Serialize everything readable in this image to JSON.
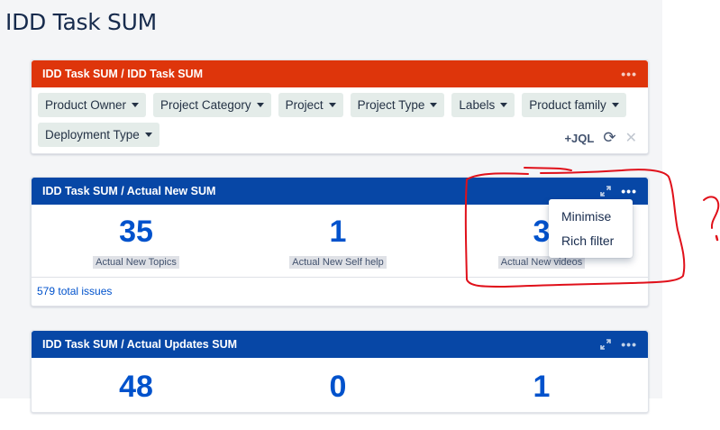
{
  "page": {
    "title": "IDD Task SUM"
  },
  "filter_gadget": {
    "title": "IDD Task SUM / IDD Task SUM",
    "menu_dots": "•••",
    "chips": [
      {
        "label": "Product Owner"
      },
      {
        "label": "Project Category"
      },
      {
        "label": "Project"
      },
      {
        "label": "Project Type"
      },
      {
        "label": "Labels"
      },
      {
        "label": "Product family"
      },
      {
        "label": "Deployment Type"
      }
    ],
    "jql_label": "+JQL",
    "refresh_glyph": "⟳",
    "clear_glyph": "✕"
  },
  "new_gadget": {
    "title": "IDD Task SUM / Actual New SUM",
    "menu_dots": "•••",
    "metrics": [
      {
        "value": "35",
        "label": "Actual New Topics"
      },
      {
        "value": "1",
        "label": "Actual New Self help"
      },
      {
        "value": "3",
        "label": "Actual New videos"
      }
    ],
    "footer": "579 total issues"
  },
  "dropdown_menu": {
    "items": [
      {
        "label": "Minimise"
      },
      {
        "label": "Rich filter"
      }
    ]
  },
  "updates_gadget": {
    "title": "IDD Task SUM / Actual Updates SUM",
    "menu_dots": "•••",
    "metrics": [
      {
        "value": "48"
      },
      {
        "value": "0"
      },
      {
        "value": "1"
      }
    ]
  },
  "colors": {
    "header_red": "#de350b",
    "header_blue": "#0747a6",
    "metric_blue": "#0052cc",
    "annotation_red": "#e0101a"
  },
  "icons": [
    "expand-icon",
    "more-icon",
    "refresh-icon",
    "clear-icon",
    "caret-down-icon"
  ]
}
